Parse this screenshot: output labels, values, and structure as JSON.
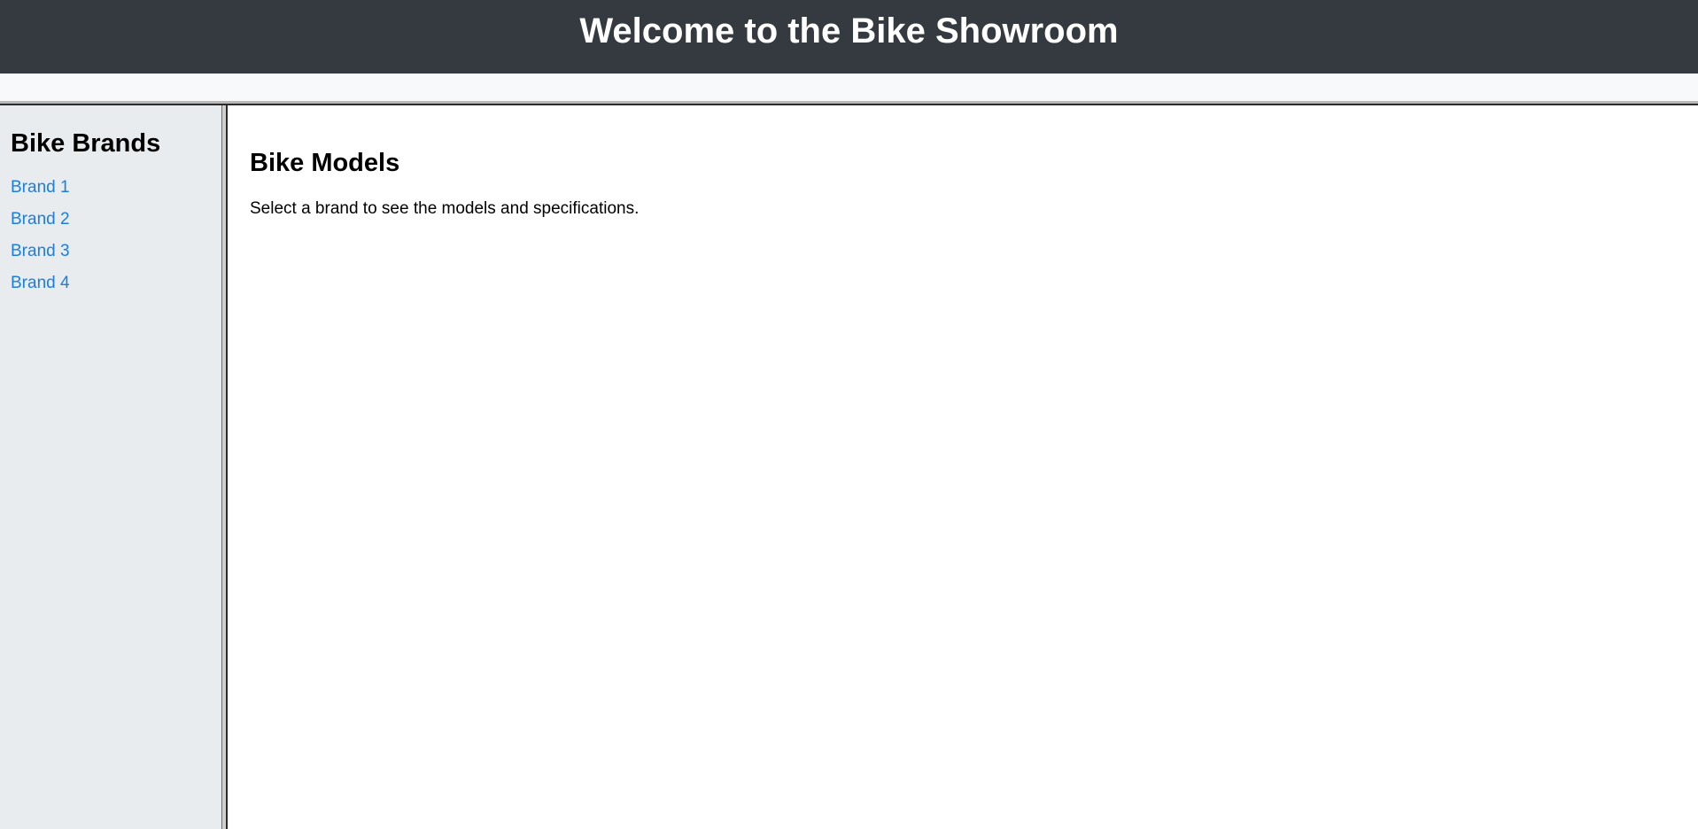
{
  "header": {
    "title": "Welcome to the Bike Showroom"
  },
  "sidebar": {
    "title": "Bike Brands",
    "brands": [
      {
        "label": "Brand 1"
      },
      {
        "label": "Brand 2"
      },
      {
        "label": "Brand 3"
      },
      {
        "label": "Brand 4"
      }
    ]
  },
  "main": {
    "title": "Bike Models",
    "description": "Select a brand to see the models and specifications."
  },
  "colors": {
    "header_bg": "#343a40",
    "sidebar_bg": "#e9ecef",
    "link": "#1a7ee0"
  }
}
